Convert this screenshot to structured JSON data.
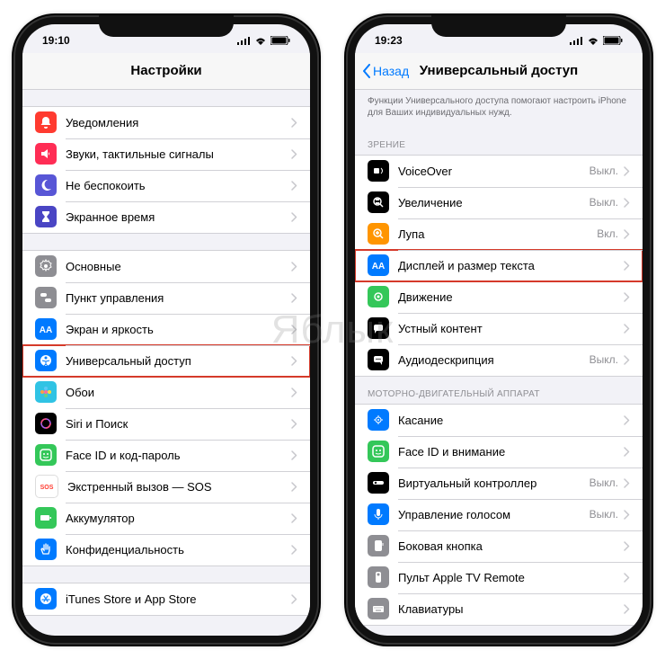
{
  "watermark": "Яблык",
  "left": {
    "time": "19:10",
    "title": "Настройки",
    "groups": [
      {
        "rows": [
          {
            "id": "notifications",
            "label": "Уведомления",
            "icon": "bell",
            "bg": "bg-red"
          },
          {
            "id": "sounds",
            "label": "Звуки, тактильные сигналы",
            "icon": "sounds",
            "bg": "bg-pink"
          },
          {
            "id": "dnd",
            "label": "Не беспокоить",
            "icon": "moon",
            "bg": "bg-purple"
          },
          {
            "id": "screentime",
            "label": "Экранное время",
            "icon": "hourglass",
            "bg": "bg-indigo"
          }
        ]
      },
      {
        "rows": [
          {
            "id": "general",
            "label": "Основные",
            "icon": "gear",
            "bg": "bg-gray"
          },
          {
            "id": "control",
            "label": "Пункт управления",
            "icon": "switches",
            "bg": "bg-gray"
          },
          {
            "id": "display",
            "label": "Экран и яркость",
            "icon": "aa",
            "bg": "bg-blue"
          },
          {
            "id": "accessibility",
            "label": "Универсальный доступ",
            "icon": "person",
            "bg": "bg-blue",
            "highlight": true
          },
          {
            "id": "wallpaper",
            "label": "Обои",
            "icon": "flower",
            "bg": "bg-teal"
          },
          {
            "id": "siri",
            "label": "Siri и Поиск",
            "icon": "siri",
            "bg": "bg-black"
          },
          {
            "id": "faceid",
            "label": "Face ID и код-пароль",
            "icon": "face",
            "bg": "bg-green"
          },
          {
            "id": "sos",
            "label": "Экстренный вызов — SOS",
            "icon": "sos",
            "bg": "bg-white-b"
          },
          {
            "id": "battery",
            "label": "Аккумулятор",
            "icon": "battery",
            "bg": "bg-green"
          },
          {
            "id": "privacy",
            "label": "Конфиденциальность",
            "icon": "hand",
            "bg": "bg-blue"
          }
        ]
      },
      {
        "rows": [
          {
            "id": "itunes",
            "label": "iTunes Store и App Store",
            "icon": "appstore",
            "bg": "bg-blue"
          }
        ]
      }
    ]
  },
  "right": {
    "time": "19:23",
    "back": "Назад",
    "title": "Универсальный доступ",
    "description": "Функции Универсального доступа помогают настроить iPhone для Ваших индивидуальных нужд.",
    "groups": [
      {
        "header": "ЗРЕНИЕ",
        "rows": [
          {
            "id": "voiceover",
            "label": "VoiceOver",
            "detail": "Выкл.",
            "icon": "vo",
            "bg": "bg-black"
          },
          {
            "id": "zoom",
            "label": "Увеличение",
            "detail": "Выкл.",
            "icon": "zoom",
            "bg": "bg-black"
          },
          {
            "id": "magnifier",
            "label": "Лупа",
            "detail": "Вкл.",
            "icon": "magnify",
            "bg": "bg-orange"
          },
          {
            "id": "displaytext",
            "label": "Дисплей и размер текста",
            "icon": "aa",
            "bg": "bg-blue",
            "highlight": true
          },
          {
            "id": "motion",
            "label": "Движение",
            "icon": "motion",
            "bg": "bg-green"
          },
          {
            "id": "spoken",
            "label": "Устный контент",
            "icon": "speech",
            "bg": "bg-black"
          },
          {
            "id": "audiodesc",
            "label": "Аудиодескрипция",
            "detail": "Выкл.",
            "icon": "audio",
            "bg": "bg-black"
          }
        ]
      },
      {
        "header": "МОТОРНО-ДВИГАТЕЛЬНЫЙ АППАРАТ",
        "rows": [
          {
            "id": "touch",
            "label": "Касание",
            "icon": "touch",
            "bg": "bg-blue"
          },
          {
            "id": "faceatt",
            "label": "Face ID и внимание",
            "icon": "face",
            "bg": "bg-green"
          },
          {
            "id": "switch",
            "label": "Виртуальный контроллер",
            "detail": "Выкл.",
            "icon": "switch",
            "bg": "bg-black"
          },
          {
            "id": "voice",
            "label": "Управление голосом",
            "detail": "Выкл.",
            "icon": "mic",
            "bg": "bg-blue"
          },
          {
            "id": "side",
            "label": "Боковая кнопка",
            "icon": "side",
            "bg": "bg-gray"
          },
          {
            "id": "tvremote",
            "label": "Пульт Apple TV Remote",
            "icon": "remote",
            "bg": "bg-gray"
          },
          {
            "id": "keyboards",
            "label": "Клавиатуры",
            "icon": "keyboard",
            "bg": "bg-gray"
          }
        ]
      }
    ]
  }
}
